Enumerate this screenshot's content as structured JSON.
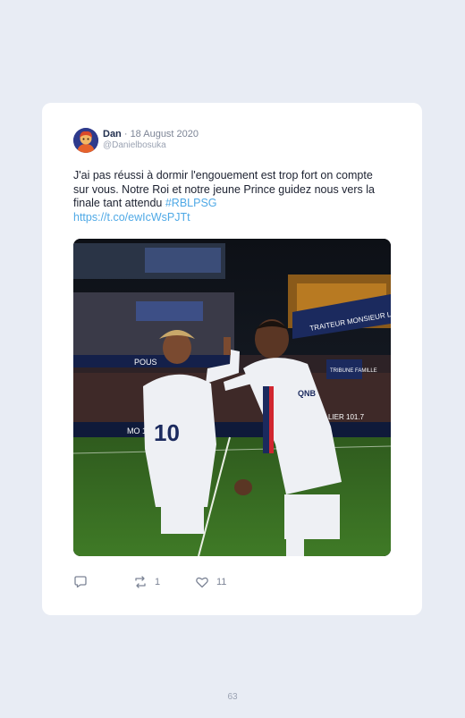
{
  "tweet": {
    "author_name": "Dan",
    "separator": " · ",
    "date": "18 August 2020",
    "handle": "@Danielbosuka",
    "text": "J'ai pas réussi à dormir l'engouement est trop fort on compte sur vous. Notre Roi et notre jeune Prince guidez nous vers la finale tant attendu ",
    "hashtag": "#RBLPSG",
    "link": "https://t.co/ewIcWsPJTt",
    "media": {
      "banner_text_right": "TRAITEUR MONSIEUR LOU",
      "sponsor_text": "QNB",
      "player_number": "10",
      "board_text": "MO  101.7",
      "board_text_right": "LIER 101.7",
      "tribune_text": "TRIBUNE FAMILLE",
      "ad_text_left": "POUS"
    },
    "retweet_count": "1",
    "like_count": "11"
  },
  "page_number": "63",
  "colors": {
    "background": "#e8ecf4",
    "card": "#ffffff",
    "link": "#4fa9e6",
    "name": "#1f2d4d"
  }
}
